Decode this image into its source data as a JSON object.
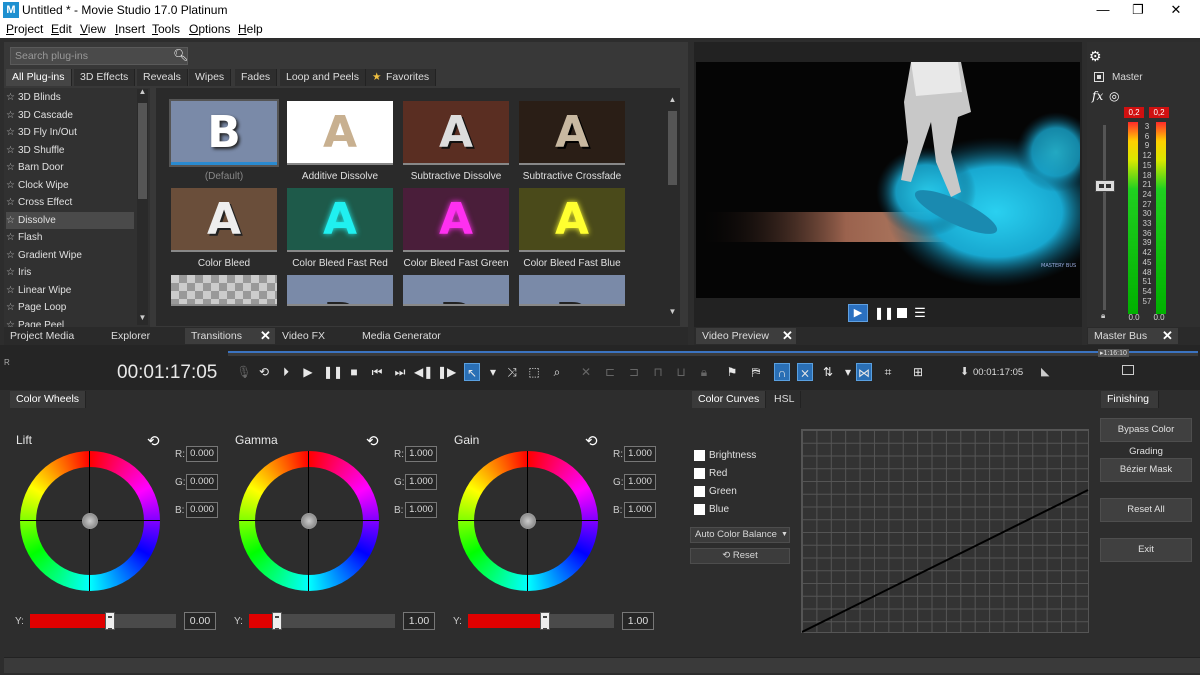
{
  "window": {
    "title": "Untitled * - Movie Studio 17.0 Platinum",
    "icon_label": "M",
    "minimize": "—",
    "maximize": "❐",
    "close": "✕"
  },
  "menu": [
    "Project",
    "Edit",
    "View",
    "Insert",
    "Tools",
    "Options",
    "Help"
  ],
  "plugins": {
    "search_placeholder": "Search plug-ins",
    "tabs": [
      "All Plug-ins",
      "3D Effects",
      "Reveals",
      "Wipes",
      "Fades",
      "Loop and Peels",
      "Favorites"
    ],
    "list": [
      "3D Blinds",
      "3D Cascade",
      "3D Fly In/Out",
      "3D Shuffle",
      "Barn Door",
      "Clock Wipe",
      "Cross Effect",
      "Dissolve",
      "Flash",
      "Gradient Wipe",
      "Iris",
      "Linear Wipe",
      "Page Loop",
      "Page Peel"
    ],
    "selected": "Dissolve",
    "thumbs": [
      {
        "label": "(Default)",
        "letter": "B"
      },
      {
        "label": "Additive Dissolve",
        "letter": "A"
      },
      {
        "label": "Subtractive Dissolve",
        "letter": "A"
      },
      {
        "label": "Subtractive Crossfade",
        "letter": "A"
      },
      {
        "label": "Color Bleed",
        "letter": "A"
      },
      {
        "label": "Color Bleed Fast Red",
        "letter": "A"
      },
      {
        "label": "Color Bleed Fast Green",
        "letter": "A"
      },
      {
        "label": "Color Bleed Fast Blue",
        "letter": "A"
      },
      {
        "label": "",
        "letter": ""
      },
      {
        "label": "",
        "letter": "B"
      },
      {
        "label": "",
        "letter": "B"
      },
      {
        "label": "",
        "letter": "B"
      }
    ]
  },
  "dock_tabs": {
    "project_media": "Project Media",
    "explorer": "Explorer",
    "transitions": "Transitions",
    "video_fx": "Video FX",
    "media_generator": "Media Generator",
    "video_preview": "Video Preview",
    "master_bus": "Master Bus"
  },
  "preview": {
    "watermark": "MASTERY BUS"
  },
  "master": {
    "label": "Master",
    "fx": "fx",
    "peak_left": "0,2",
    "peak_right": "0,2",
    "scale": [
      "3",
      "6",
      "9",
      "12",
      "15",
      "18",
      "21",
      "24",
      "27",
      "30",
      "33",
      "36",
      "39",
      "42",
      "45",
      "48",
      "51",
      "54",
      "57"
    ],
    "bottom_left": "0.0",
    "bottom_right": "0.0"
  },
  "timeline": {
    "timecode": "00:01:17:05",
    "cursor_time": "00:01:17:05",
    "ruler_marker": "▸1:16:10"
  },
  "color_wheels": {
    "tab": "Color Wheels",
    "wheels": [
      {
        "name": "Lift",
        "r": "0.000",
        "g": "0.000",
        "b": "0.000",
        "y": "0.00",
        "y_level": 0.55
      },
      {
        "name": "Gamma",
        "r": "1.000",
        "g": "1.000",
        "b": "1.000",
        "y": "1.00",
        "y_level": 0.19
      },
      {
        "name": "Gain",
        "r": "1.000",
        "g": "1.000",
        "b": "1.000",
        "y": "1.00",
        "y_level": 0.53
      }
    ],
    "r_label": "R:",
    "g_label": "G:",
    "b_label": "B:",
    "y_label": "Y:"
  },
  "curves": {
    "tabs": [
      "Color Curves",
      "HSL"
    ],
    "channels": [
      "Brightness",
      "Red",
      "Green",
      "Blue"
    ],
    "auto_balance": "Auto Color Balance",
    "reset": "Reset"
  },
  "finishing": {
    "tab": "Finishing",
    "buttons": [
      "Bypass Color Grading",
      "Bézier Mask",
      "Reset All",
      "Exit"
    ]
  }
}
